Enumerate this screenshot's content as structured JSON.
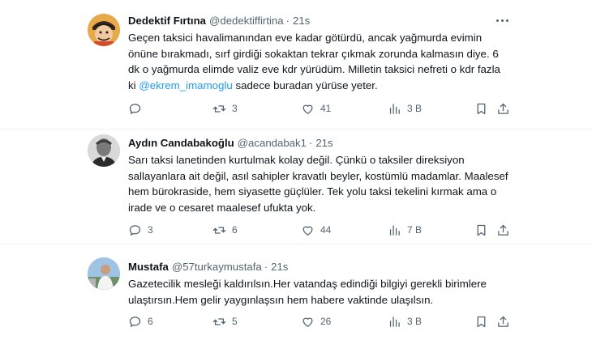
{
  "tweets": [
    {
      "name": "Dedektif Fırtına",
      "handle": "@dedektiffirtina",
      "dot": "·",
      "time": "21s",
      "text_before": "Geçen taksici havalimanından eve kadar götürdü, ancak yağmurda evimin önüne bırakmadı, sırf girdiği sokaktan tekrar çıkmak zorunda kalmasın diye. 6 dk o yağmurda elimde valiz eve kdr yürüdüm. Milletin taksici nefreti o kdr fazla ki ",
      "mention": "@ekrem_imamoglu",
      "text_after": " sadece buradan yürüse yeter.",
      "replies": "",
      "retweets": "3",
      "likes": "41",
      "views": "3 B"
    },
    {
      "name": "Aydın Candabakoğlu",
      "handle": "@acandabak1",
      "dot": "·",
      "time": "21s",
      "text_before": "Sarı taksi lanetinden kurtulmak kolay değil. Çünkü o taksiler direksiyon sallayanlara ait değil, asıl sahipler kravatlı beyler, kostümlü madamlar. Maalesef hem bürokraside, hem siyasette güçlüler. Tek yolu taksi tekelini kırmak ama o irade ve o cesaret maalesef ufukta yok.",
      "mention": "",
      "text_after": "",
      "replies": "3",
      "retweets": "6",
      "likes": "44",
      "views": "7 B"
    },
    {
      "name": "Mustafa",
      "handle": "@57turkaymustafa",
      "dot": "·",
      "time": "21s",
      "text_before": "Gazetecilik mesleği kaldırılsın.Her vatandaş edindiği bilgiyi gerekli birimlere ulaştırsın.Hem gelir yaygınlaşsın hem habere vaktinde ulaşılsın.",
      "mention": "",
      "text_after": "",
      "replies": "6",
      "retweets": "5",
      "likes": "26",
      "views": "3 B"
    }
  ],
  "icons": {
    "reply": "reply-icon",
    "retweet": "retweet-icon",
    "like": "heart-icon",
    "views": "views-chart-icon",
    "bookmark": "bookmark-icon",
    "share": "share-icon",
    "more": "more-icon"
  },
  "colors": {
    "link": "#1d9bf0",
    "secondary_text": "#536471",
    "divider": "#eff3f4"
  }
}
